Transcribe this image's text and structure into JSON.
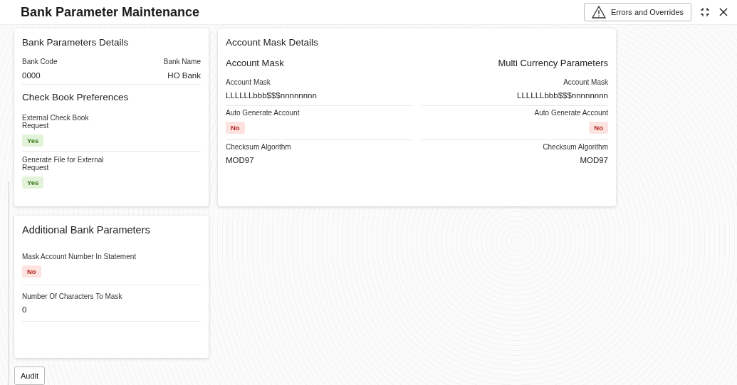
{
  "header": {
    "title": "Bank Parameter Maintenance",
    "errors_button": "Errors and Overrides"
  },
  "bank_details": {
    "title": "Bank Parameters Details",
    "fields": [
      {
        "label": "Bank Code",
        "value": "0000"
      },
      {
        "label": "Bank Name",
        "value": "HO Bank"
      }
    ],
    "check_book": {
      "title": "Check Book Preferences",
      "fields": [
        {
          "label": "External Check Book Request",
          "value": "Yes",
          "on": true
        },
        {
          "label": "Generate File for External Request",
          "value": "Yes",
          "on": true
        }
      ]
    }
  },
  "account_mask_details": {
    "title": "Account Mask Details",
    "columns": [
      {
        "title": "Account Mask",
        "fields": [
          {
            "label": "Account Mask",
            "kind": "text",
            "value": "LLLLLLbbb$$$nnnnnnnn"
          },
          {
            "label": "Auto Generate Account",
            "kind": "flag",
            "value": "No",
            "on": false
          },
          {
            "label": "Checksum Algorithm",
            "kind": "text",
            "value": "MOD97"
          }
        ]
      },
      {
        "title": "Multi Currency Parameters",
        "fields": [
          {
            "label": "Account Mask",
            "kind": "text",
            "value": "LLLLLLbbb$$$nnnnnnnn"
          },
          {
            "label": "Auto Generate Account",
            "kind": "flag",
            "value": "No",
            "on": false
          },
          {
            "label": "Checksum Algorithm",
            "kind": "text",
            "value": "MOD97"
          }
        ]
      }
    ]
  },
  "additional": {
    "title": "Additional Bank Parameters",
    "fields": [
      {
        "label": "Mask Account Number In Statement",
        "kind": "flag",
        "value": "No",
        "on": false
      },
      {
        "label": "Number Of Characters To Mask",
        "kind": "text",
        "value": "0"
      }
    ]
  },
  "footer": {
    "audit_button": "Audit"
  }
}
